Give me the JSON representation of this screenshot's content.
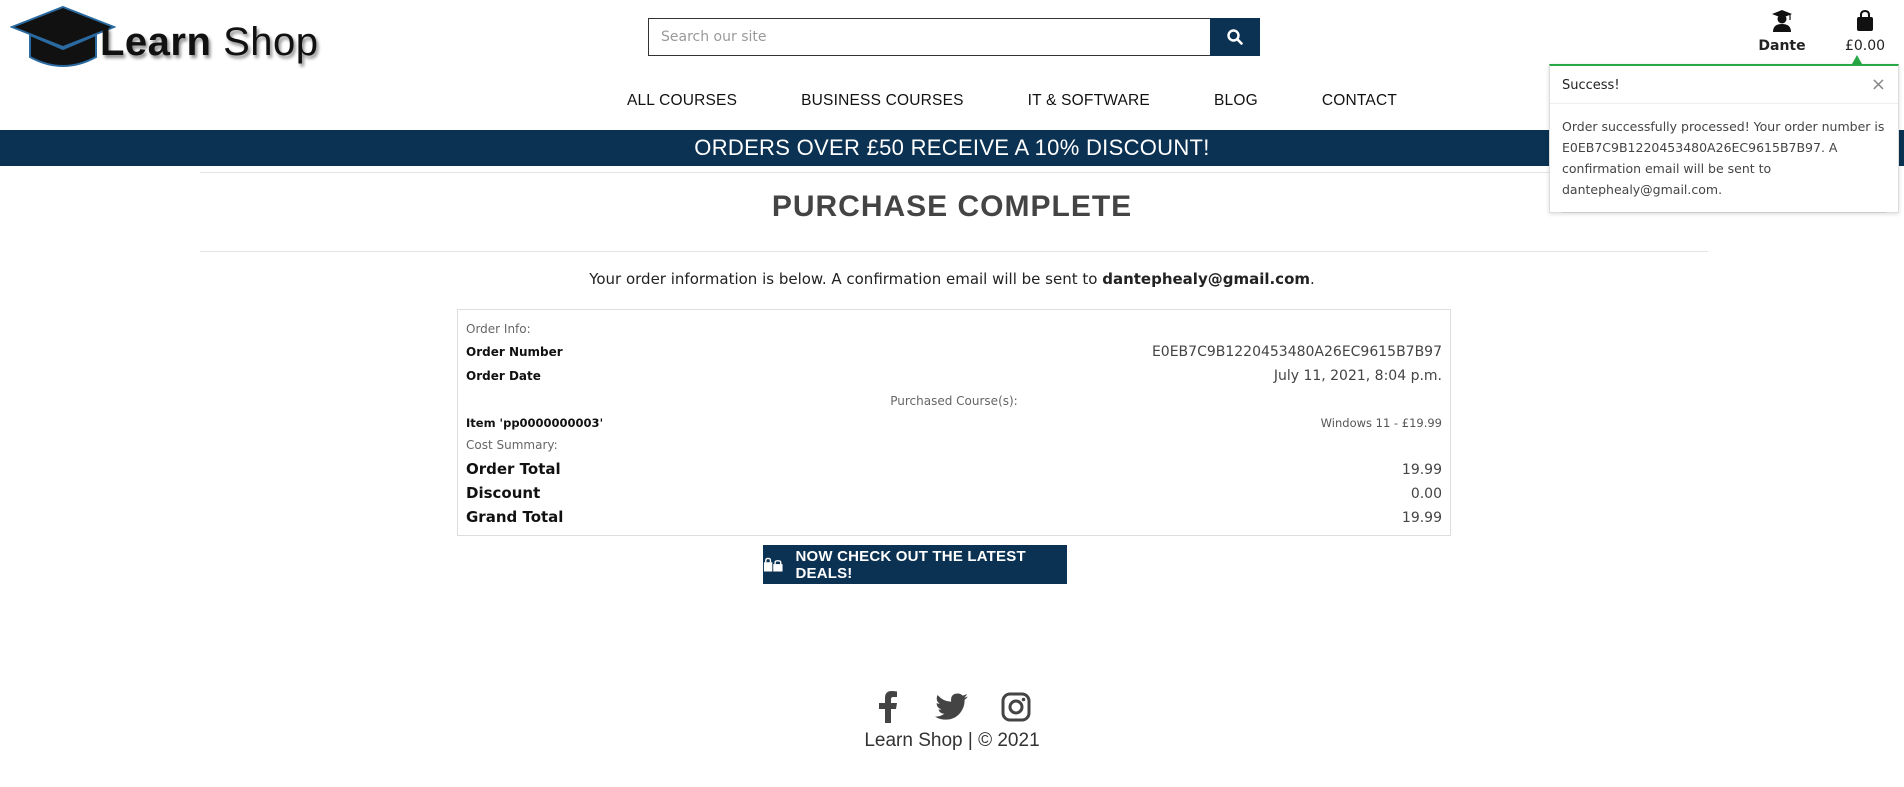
{
  "brand": {
    "name_part1": "Learn",
    "name_part2": "Shop"
  },
  "search": {
    "placeholder": "Search our site"
  },
  "account": {
    "user_label": "Dante",
    "cart_total": "£0.00"
  },
  "nav": {
    "items": [
      {
        "label": "ALL COURSES"
      },
      {
        "label": "BUSINESS COURSES"
      },
      {
        "label": "IT & SOFTWARE"
      },
      {
        "label": "BLOG"
      },
      {
        "label": "CONTACT"
      }
    ]
  },
  "promo": {
    "text": "ORDERS OVER £50 RECEIVE A 10% DISCOUNT!"
  },
  "page": {
    "title": "PURCHASE COMPLETE",
    "intro_text": "Your order information is below. A confirmation email will be sent to ",
    "intro_email": "dantephealy@gmail.com",
    "intro_end": "."
  },
  "order": {
    "order_info_label": "Order Info:",
    "order_number_label": "Order Number",
    "order_number": "E0EB7C9B1220453480A26EC9615B7B97",
    "order_date_label": "Order Date",
    "order_date": "July 11, 2021, 8:04 p.m.",
    "purchased_label": "Purchased Course(s):",
    "item_label": "Item 'pp0000000003'",
    "item_value": "Windows 11 - £19.99",
    "cost_summary_label": "Cost Summary:",
    "order_total_label": "Order Total",
    "order_total": "19.99",
    "discount_label": "Discount",
    "discount": "0.00",
    "grand_total_label": "Grand Total",
    "grand_total": "19.99"
  },
  "deals_button": {
    "label": "NOW CHECK OUT THE LATEST DEALS!"
  },
  "footer": {
    "text": "Learn Shop | © 2021"
  },
  "toast": {
    "title": "Success!",
    "close": "×",
    "message": "Order successfully processed! Your order number is E0EB7C9B1220453480A26EC9615B7B97. A confirmation email will be sent to dantephealy@gmail.com."
  },
  "colors": {
    "brand_navy": "#0b3253",
    "success_green": "#28a745"
  },
  "icons": {
    "logo": "graduation-cap-icon",
    "search": "search-icon",
    "user": "user-graduate-icon",
    "cart": "shopping-bag-icon",
    "deals": "shopping-icon",
    "facebook": "facebook-icon",
    "twitter": "twitter-icon",
    "instagram": "instagram-icon"
  }
}
